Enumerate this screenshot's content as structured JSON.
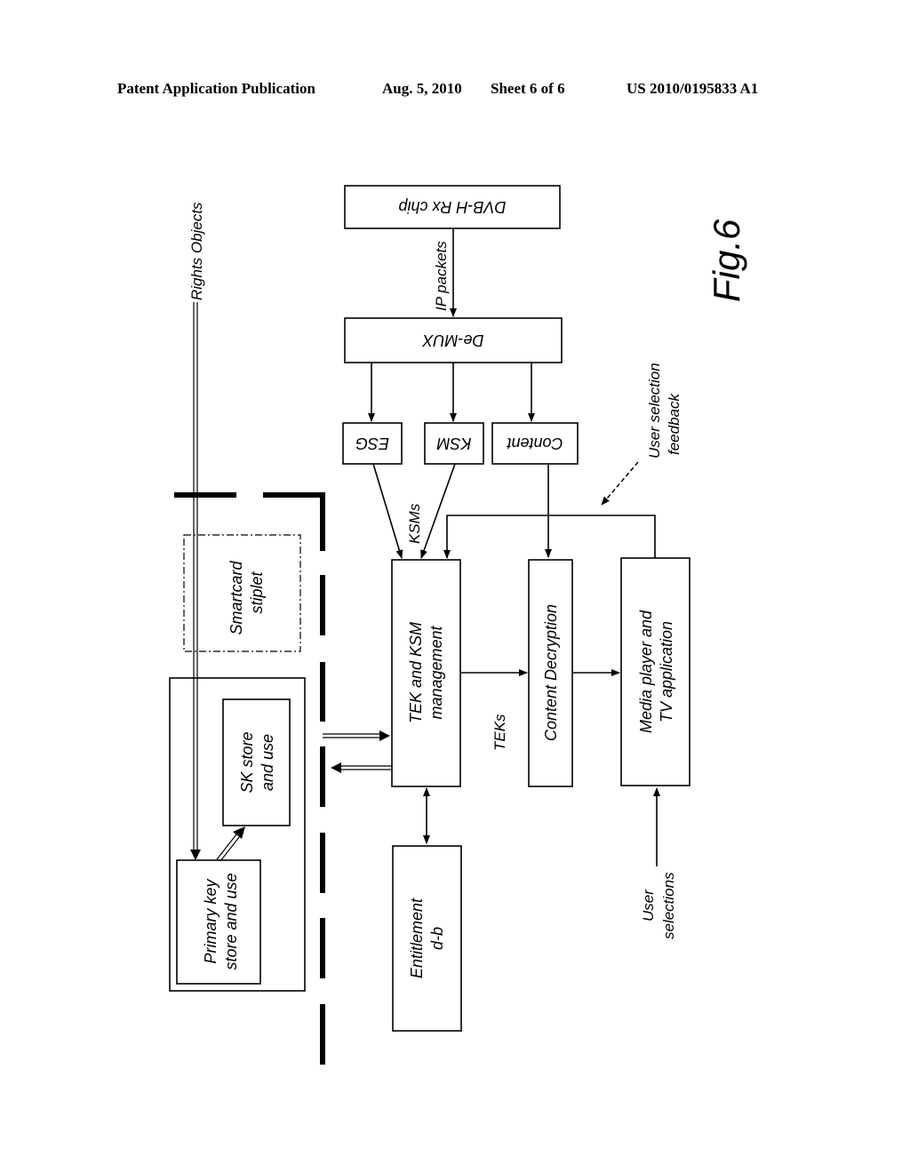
{
  "header": {
    "publication": "Patent Application Publication",
    "date": "Aug. 5, 2010",
    "sheet": "Sheet 6 of 6",
    "number": "US 2010/0195833 A1"
  },
  "figure": {
    "label": "Fig.6",
    "blocks": {
      "dvbh": "DVB-H Rx chip",
      "demux": "De-MUX",
      "esg": "ESG",
      "ksm": "KSM",
      "content": "Content",
      "tek_line1": "TEK and KSM",
      "tek_line2": "management",
      "decrypt": "Content Decryption",
      "media_line1": "Media player and",
      "media_line2": "TV application",
      "entitlement_line1": "Entitlement",
      "entitlement_line2": "d-b",
      "smartcard_line1": "Smartcard",
      "smartcard_line2": "stiplet",
      "sk_line1": "SK store",
      "sk_line2": "and use",
      "primary_line1": "Primary key",
      "primary_line2": "store and use"
    },
    "labels": {
      "ip_packets": "IP packets",
      "ksms": "KSMs",
      "teks": "TEKs",
      "rights_objects": "Rights Objects",
      "feedback_line1": "User selection",
      "feedback_line2": "feedback",
      "user_sel_line1": "User",
      "user_sel_line2": "selections"
    }
  }
}
